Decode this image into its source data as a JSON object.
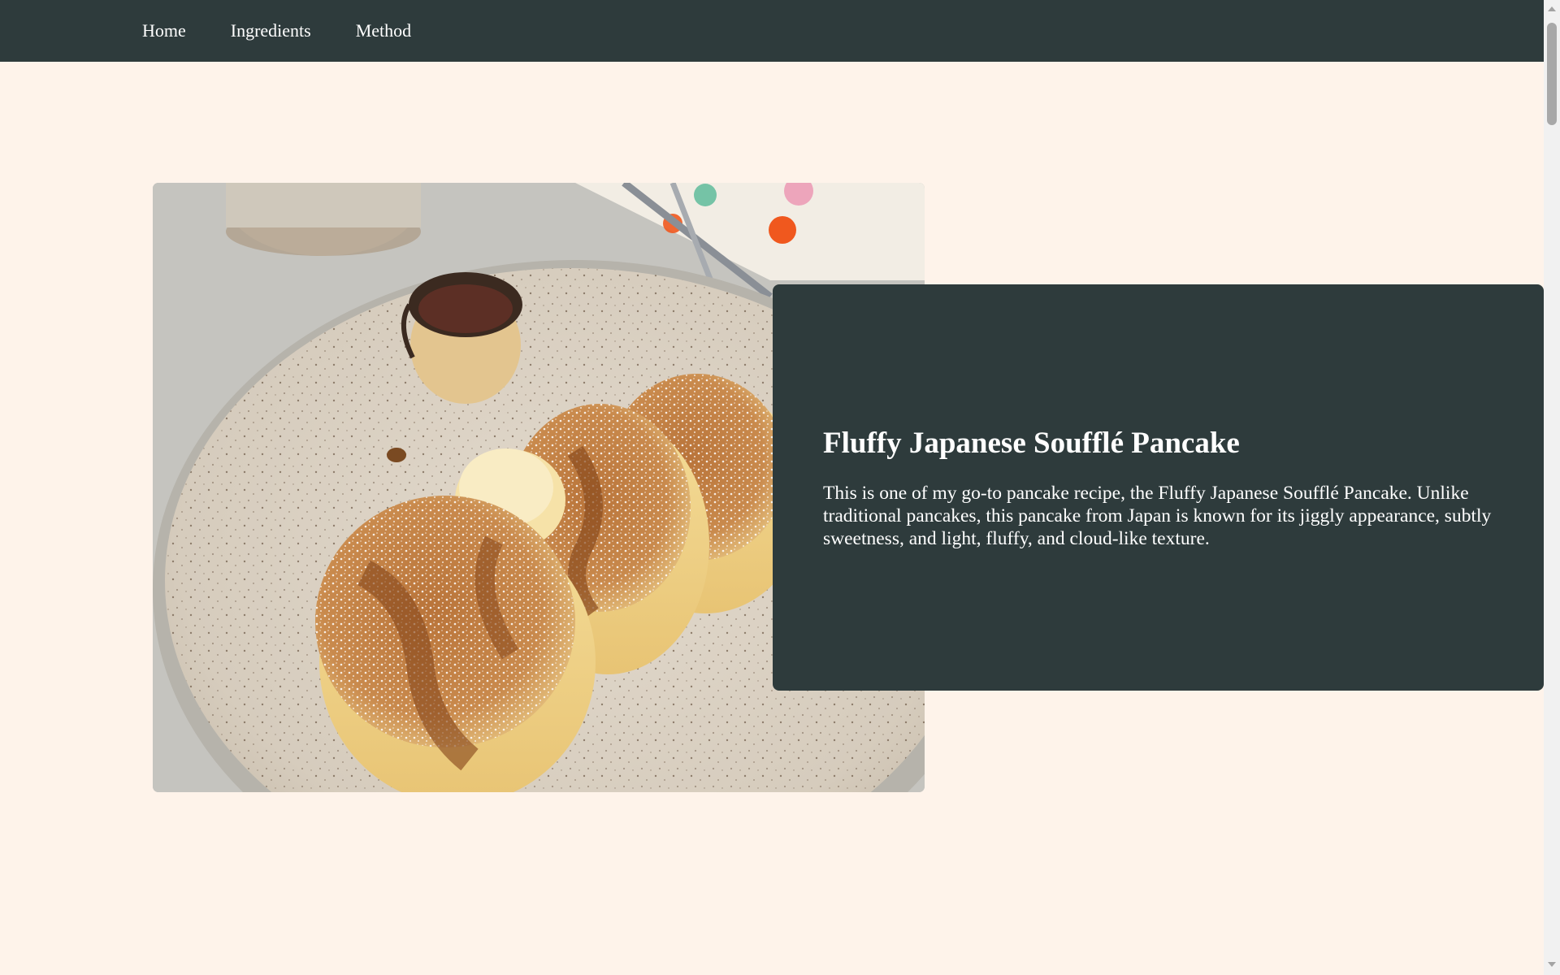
{
  "nav": {
    "items": [
      {
        "label": "Home"
      },
      {
        "label": "Ingredients"
      },
      {
        "label": "Method"
      }
    ]
  },
  "hero": {
    "image_icon": "pancake-photo",
    "title": "Fluffy Japanese Soufflé Pancake",
    "description": "This is one of my go-to pancake recipe, the Fluffy Japanese Soufflé Pancake. Unlike traditional pancakes, this pancake from Japan is known for its jiggly appearance, subtly sweetness, and light, fluffy, and cloud-like texture."
  },
  "colors": {
    "page_background": "#fef3ea",
    "nav_background": "#2e3b3c",
    "card_background": "#2e3b3c",
    "text_light": "#ffffff"
  }
}
